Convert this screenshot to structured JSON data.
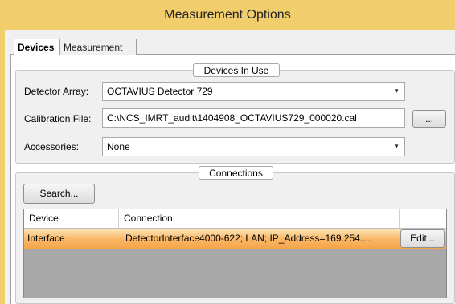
{
  "window": {
    "title": "Measurement Options"
  },
  "tabs": [
    {
      "label": "Devices",
      "active": true
    },
    {
      "label": "Measurement",
      "active": false
    }
  ],
  "devices_in_use": {
    "legend": "Devices In Use",
    "detector_array": {
      "label": "Detector Array:",
      "value": "OCTAVIUS Detector 729"
    },
    "calibration_file": {
      "label": "Calibration File:",
      "value": "C:\\NCS_IMRT_audit\\1404908_OCTAVIUS729_000020.cal",
      "browse_label": "..."
    },
    "accessories": {
      "label": "Accessories:",
      "value": "None"
    }
  },
  "connections": {
    "legend": "Connections",
    "search_label": "Search...",
    "columns": [
      "Device",
      "Connection"
    ],
    "rows": [
      {
        "device": "Interface",
        "connection": "DetectorInterface4000-622; LAN; IP_Address=169.254....",
        "edit_label": "Edit..."
      }
    ]
  },
  "colors": {
    "titlebar": "#f1cd6c",
    "selected_row": "#f9b665"
  }
}
